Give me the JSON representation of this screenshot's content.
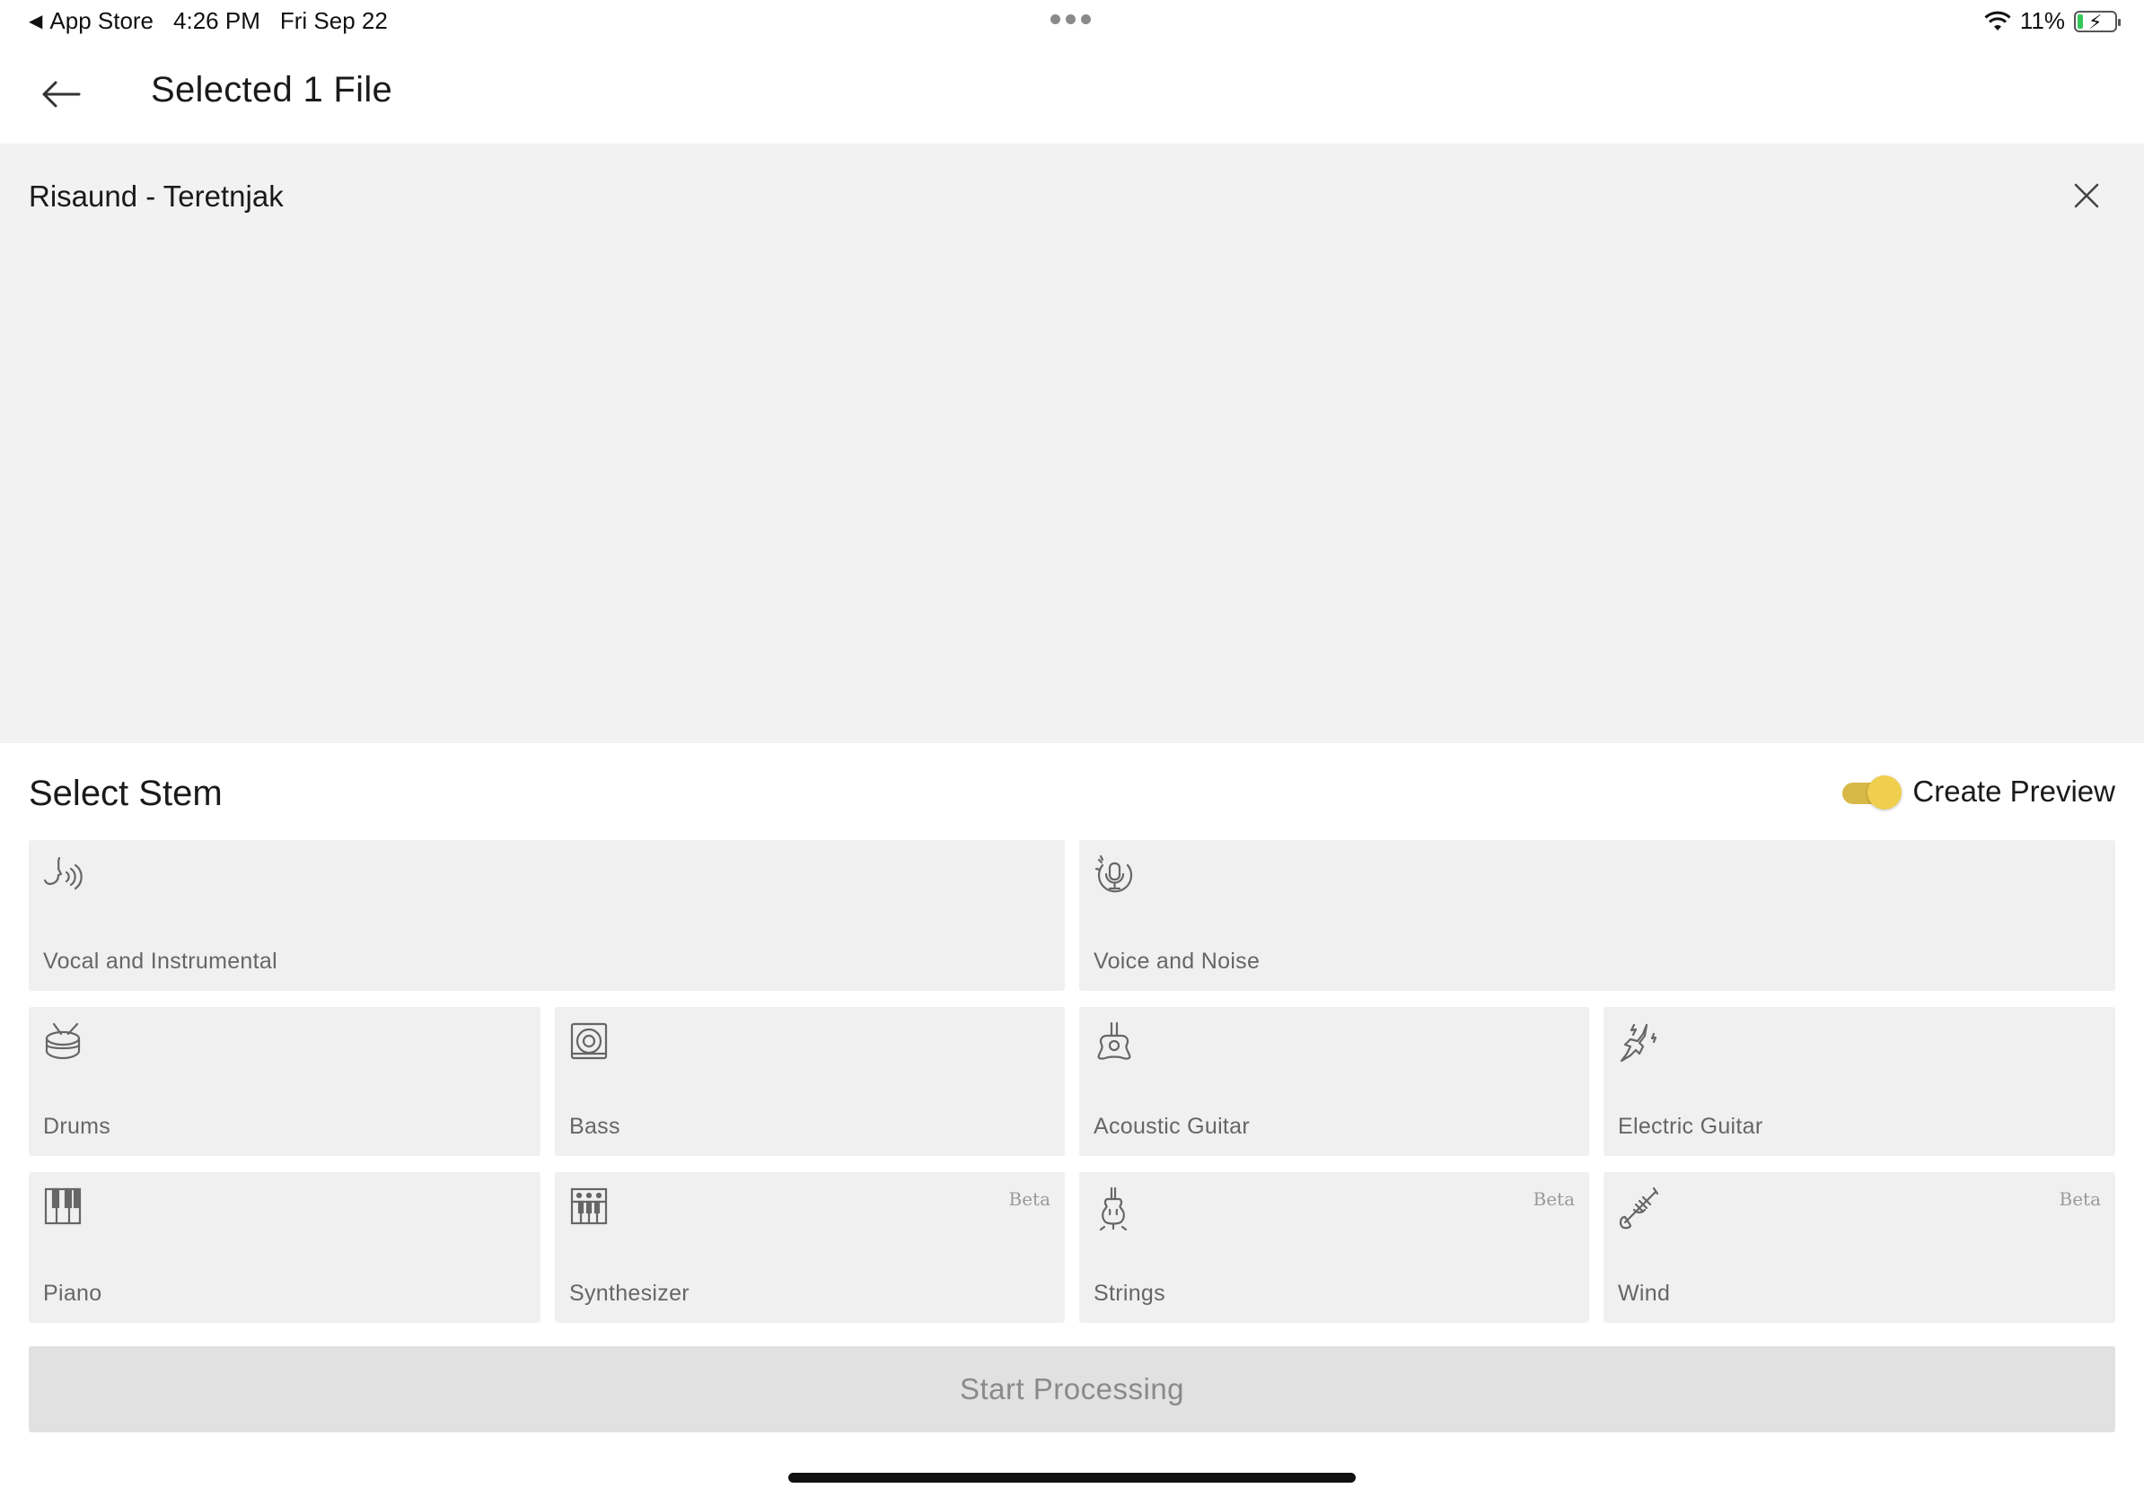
{
  "status_bar": {
    "back_app": "App Store",
    "time": "4:26 PM",
    "date": "Fri Sep 22",
    "battery": "11%"
  },
  "header": {
    "title": "Selected 1 File"
  },
  "file": {
    "name": "Risaund - Teretnjak"
  },
  "stems": {
    "title": "Select Stem",
    "create_preview_label": "Create Preview",
    "create_preview_on": true,
    "items": [
      {
        "label": "Vocal and Instrumental",
        "icon": "vocal-icon",
        "beta": ""
      },
      {
        "label": "Voice and Noise",
        "icon": "microphone-noise-icon",
        "beta": ""
      },
      {
        "label": "Drums",
        "icon": "drum-icon",
        "beta": ""
      },
      {
        "label": "Bass",
        "icon": "speaker-icon",
        "beta": ""
      },
      {
        "label": "Acoustic Guitar",
        "icon": "acoustic-guitar-icon",
        "beta": ""
      },
      {
        "label": "Electric Guitar",
        "icon": "electric-guitar-icon",
        "beta": ""
      },
      {
        "label": "Piano",
        "icon": "piano-icon",
        "beta": ""
      },
      {
        "label": "Synthesizer",
        "icon": "synthesizer-icon",
        "beta": "Beta"
      },
      {
        "label": "Strings",
        "icon": "violin-icon",
        "beta": "Beta"
      },
      {
        "label": "Wind",
        "icon": "trumpet-icon",
        "beta": "Beta"
      }
    ]
  },
  "actions": {
    "start_label": "Start Processing"
  },
  "colors": {
    "accent_toggle": "#f0cf4e",
    "panel_bg": "#f2f2f2",
    "tile_bg": "#f0f0f0",
    "button_bg": "#e1e1e1"
  }
}
